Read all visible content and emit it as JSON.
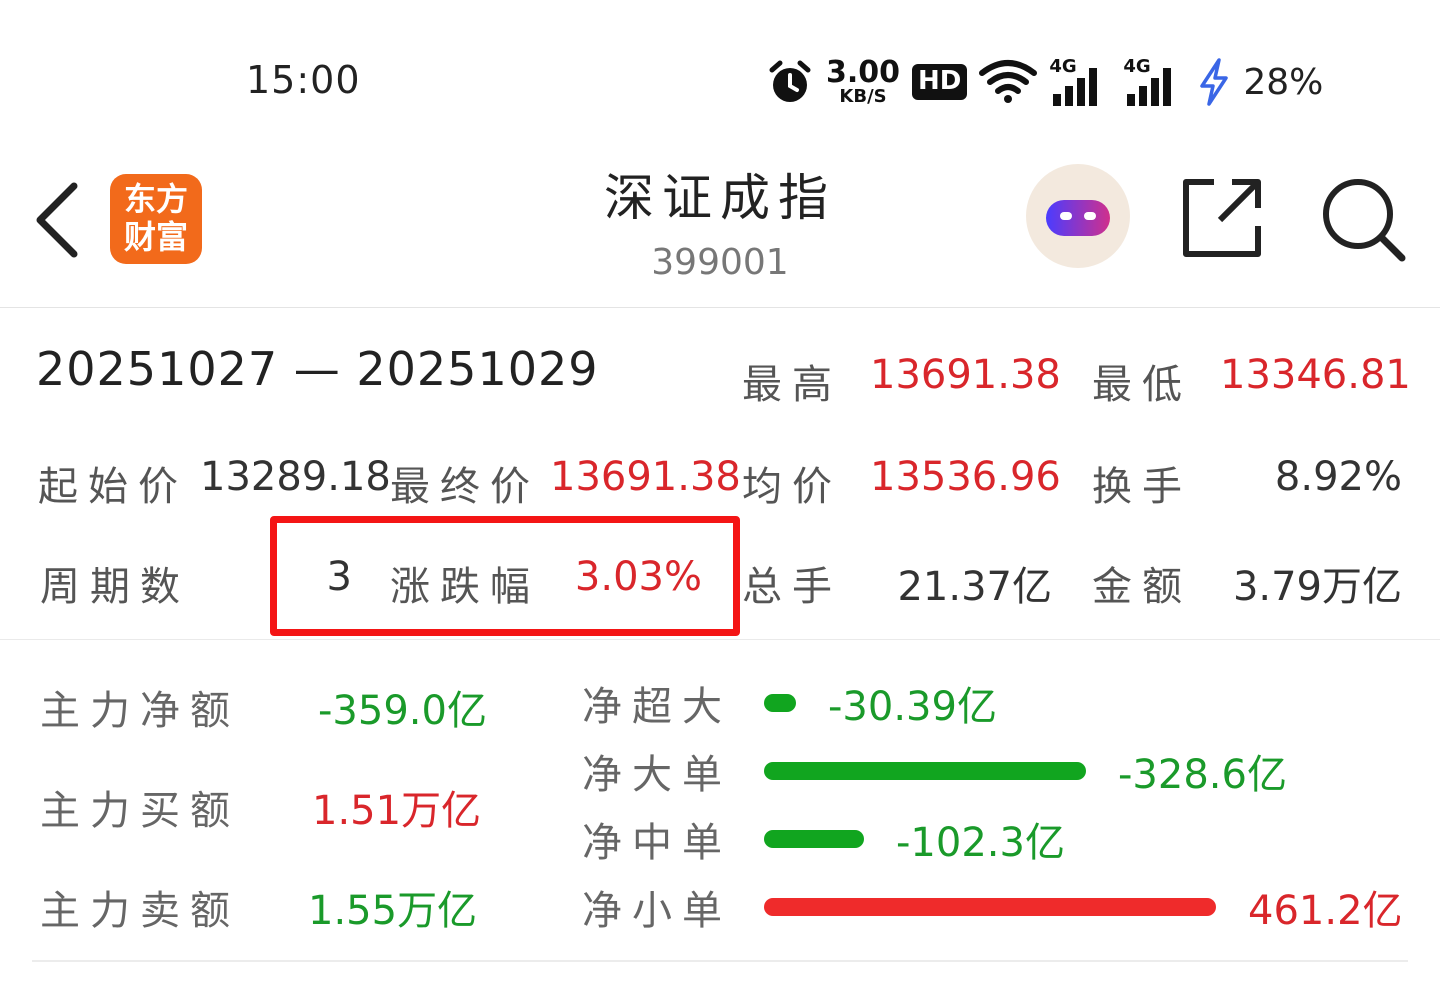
{
  "status_bar": {
    "time": "15:00",
    "net_speed_value": "3.00",
    "net_speed_unit": "KB/S",
    "hd_label": "HD",
    "signal1": "4G",
    "signal2": "4G",
    "battery": "28%"
  },
  "header": {
    "logo_line1": "东方",
    "logo_line2": "财富",
    "title": "深证成指",
    "code": "399001"
  },
  "stats": {
    "date_range": "20251027 — 20251029",
    "high_label": "最高",
    "high_value": "13691.38",
    "low_label": "最低",
    "low_value": "13346.81",
    "open_label": "起始价",
    "open_value": "13289.18",
    "close_label": "最终价",
    "close_value": "13691.38",
    "avg_label": "均价",
    "avg_value": "13536.96",
    "turnover_label": "换手",
    "turnover_value": "8.92%",
    "periods_label": "周期数",
    "periods_value": "3",
    "change_label": "涨跌幅",
    "change_value": "3.03%",
    "volume_label": "总手",
    "volume_value": "21.37亿",
    "amount_label": "金额",
    "amount_value": "3.79万亿"
  },
  "flow": {
    "main_net_label": "主力净额",
    "main_net_value": "-359.0亿",
    "main_buy_label": "主力买额",
    "main_buy_value": "1.51万亿",
    "main_sell_label": "主力卖额",
    "main_sell_value": "1.55万亿",
    "rows": [
      {
        "label": "净超大",
        "value": "-30.39亿",
        "amount": -30.39,
        "color": "#11a51f"
      },
      {
        "label": "净大单",
        "value": "-328.6亿",
        "amount": -328.6,
        "color": "#11a51f"
      },
      {
        "label": "净中单",
        "value": "-102.3亿",
        "amount": -102.3,
        "color": "#11a51f"
      },
      {
        "label": "净小单",
        "value": "461.2亿",
        "amount": 461.2,
        "color": "#ef2b2b"
      }
    ]
  },
  "colors": {
    "up": "#d9262b",
    "down": "#1a9a2a",
    "highlight_box": "#f41515",
    "logo_bg": "#f26a1b"
  }
}
